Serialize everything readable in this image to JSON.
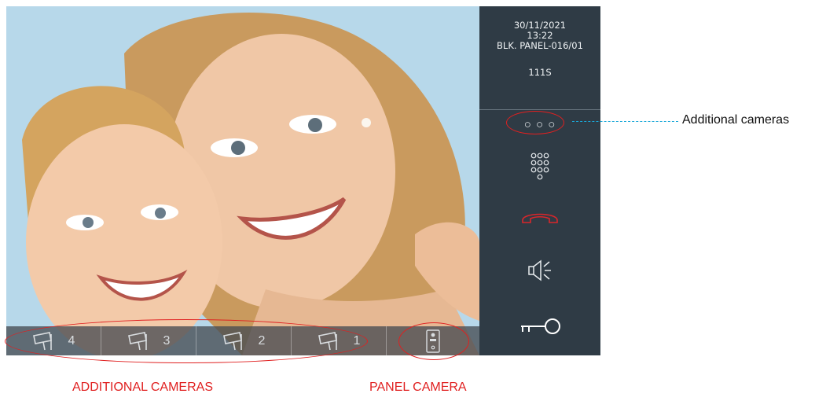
{
  "info": {
    "date": "30/11/2021",
    "time": "13:22",
    "panel": "BLK. PANEL-016/01",
    "unit": "111S"
  },
  "side_buttons": [
    {
      "name": "more-cameras-button",
      "glyph": "○ ○ ○"
    },
    {
      "name": "keypad-button",
      "icon": "keypad-icon"
    },
    {
      "name": "hang-up-button",
      "icon": "handset-icon",
      "color": "#d9262b"
    },
    {
      "name": "speaker-button",
      "icon": "speaker-icon"
    },
    {
      "name": "unlock-button",
      "icon": "key-icon"
    }
  ],
  "camera_bar": {
    "cameras": [
      {
        "label": "4"
      },
      {
        "label": "3"
      },
      {
        "label": "2"
      },
      {
        "label": "1"
      }
    ],
    "panel_camera_icon": "door-panel-icon"
  },
  "annotations": {
    "additional_cameras_right": "Additional cameras",
    "additional_cameras_bottom": "ADDITIONAL CAMERAS",
    "panel_camera_bottom": "PANEL CAMERA",
    "ring_color": "#e02020",
    "lead_color": "#1aa8d8"
  },
  "colors": {
    "side_panel": "#2f3b45",
    "camera_bar": "#464c52",
    "hangup": "#d9262b"
  }
}
